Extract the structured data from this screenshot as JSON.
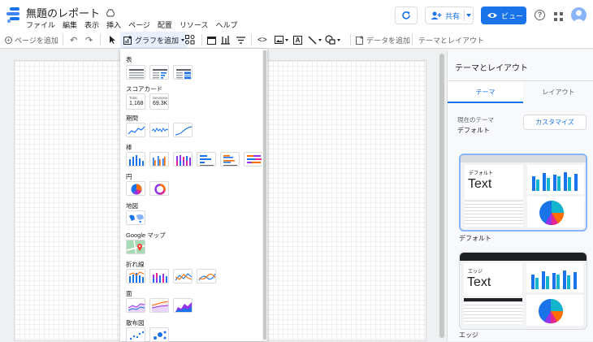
{
  "app": {
    "title": "無題のレポート"
  },
  "menubar": [
    "ファイル",
    "編集",
    "表示",
    "挿入",
    "ページ",
    "配置",
    "リソース",
    "ヘルプ"
  ],
  "header": {
    "share_label": "共有",
    "view_label": "ビュー"
  },
  "toolbar": {
    "add_page": "ページを追加",
    "add_chart": "グラフを追加",
    "add_data": "データを追加",
    "theme_layout": "テーマとレイアウト"
  },
  "chart_menu": {
    "sections": [
      "表",
      "スコアカード",
      "期間",
      "棒",
      "円",
      "地図",
      "Google マップ",
      "折れ線",
      "面",
      "散布図"
    ],
    "scorecards": [
      {
        "label": "Total",
        "value": "1,168"
      },
      {
        "label": "Sessions",
        "value": "69.3K"
      }
    ]
  },
  "right_panel": {
    "title": "テーマとレイアウト",
    "tabs": [
      "テーマ",
      "レイアウト"
    ],
    "current_theme_label": "現在のテーマ",
    "current_theme_value": "デフォルト",
    "customize_button": "カスタマイズ",
    "themes": [
      {
        "header": "デフォルト",
        "sample_text": "Text",
        "caption": "デフォルト"
      },
      {
        "header": "エッジ",
        "sample_text": "Text",
        "caption": "エッジ"
      }
    ]
  },
  "colors": {
    "accent": "#1a73e8",
    "orange": "#ff6d00",
    "purple": "#9334e6",
    "pink": "#e52592",
    "teal": "#12b5cb",
    "dark": "#202124"
  }
}
